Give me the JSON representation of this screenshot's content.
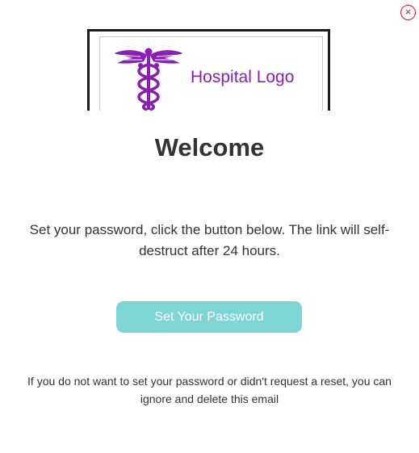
{
  "close": {
    "glyph": "×",
    "icon": "close-circle-icon"
  },
  "logo": {
    "text": "Hospital Logo",
    "icon": "caduceus-icon",
    "color": "#8a1fb5"
  },
  "heading": "Welcome",
  "message": "Set your password, click the button below. The link will self-destruct after 24 hours.",
  "button": {
    "label": "Set Your Password",
    "color": "#7dd5d5"
  },
  "footer_note": "If you do not want to set your password or didn't request a reset, you can ignore and delete this email",
  "colors": {
    "close": "#d6182b",
    "text": "#333333"
  }
}
